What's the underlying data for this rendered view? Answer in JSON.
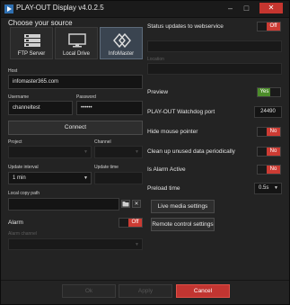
{
  "window": {
    "title": "PLAY-OUT Display v4.0.2.5",
    "minimize_glyph": "–",
    "maximize_glyph": "□",
    "close_glyph": "✕"
  },
  "left": {
    "source_heading": "Choose your source",
    "sources": [
      {
        "label": "FTP Server",
        "icon": "server-icon"
      },
      {
        "label": "Local Drive",
        "icon": "monitor-icon"
      },
      {
        "label": "InfoMaster",
        "icon": "infomaster-icon"
      }
    ],
    "host": {
      "label": "Host",
      "value": "infomaster365.com"
    },
    "username": {
      "label": "Username",
      "value": "channeltest"
    },
    "password": {
      "label": "Password",
      "value": "••••••"
    },
    "connect_label": "Connect",
    "project": {
      "label": "Project",
      "value": ""
    },
    "channel": {
      "label": "Channel",
      "value": ""
    },
    "update_interval": {
      "label": "Update interval",
      "value": "1 min"
    },
    "update_time": {
      "label": "Update time",
      "value": ""
    },
    "local_copy_path": {
      "label": "Local copy path",
      "value": ""
    },
    "alarm": {
      "label": "Alarm",
      "state": "Off"
    },
    "alarm_channel": {
      "label": "Alarm channel",
      "value": ""
    }
  },
  "right": {
    "status_updates": {
      "label": "Status updates to webservice",
      "state": "Off"
    },
    "location_label": "Location",
    "preview": {
      "label": "Preview",
      "state": "Yes"
    },
    "watchdog": {
      "label": "PLAY-OUT Watchdog port",
      "value": "24490"
    },
    "hide_mouse": {
      "label": "Hide mouse pointer",
      "state": "No"
    },
    "cleanup": {
      "label": "Clean up unused data periodically",
      "state": "No"
    },
    "alarm_active": {
      "label": "Is Alarm Active",
      "state": "No"
    },
    "preload": {
      "label": "Preload time",
      "value": "0.5s"
    },
    "live_media_label": "Live media settings",
    "remote_control_label": "Remote control settings"
  },
  "footer": {
    "ok_label": "Ok",
    "apply_label": "Apply",
    "cancel_label": "Cancel"
  },
  "colors": {
    "accent_red": "#cc3b33",
    "accent_green": "#4c8c2a",
    "active_tile": "#3a4450"
  }
}
